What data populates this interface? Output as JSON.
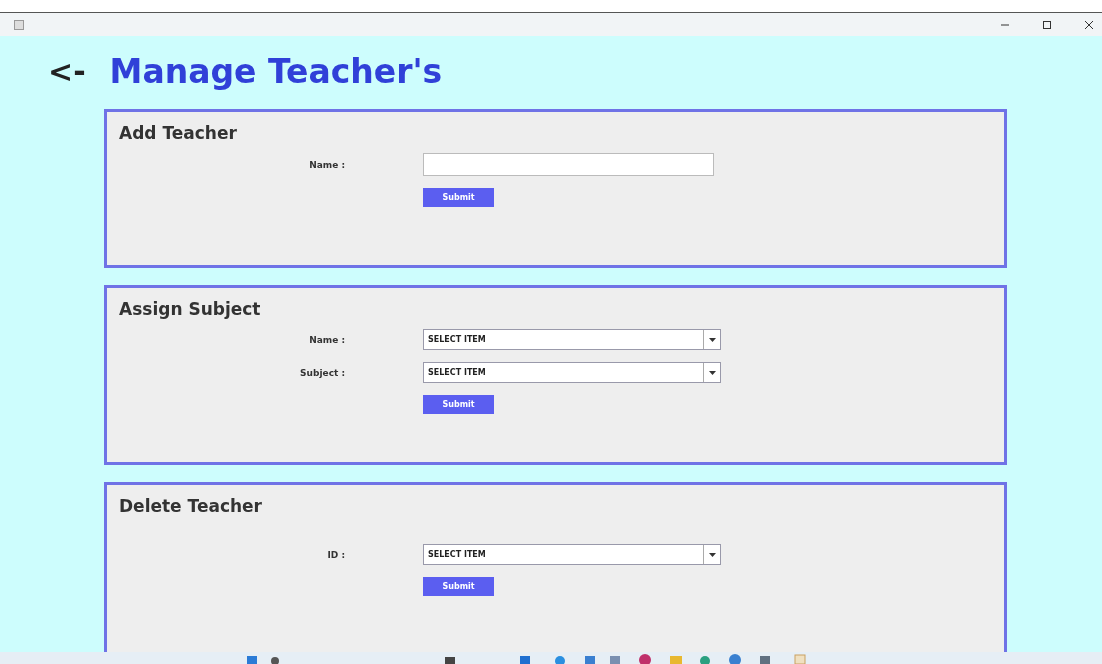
{
  "header": {
    "back": "<-",
    "title": "Manage Teacher's"
  },
  "sections": [
    {
      "heading": "Add Teacher",
      "fields": [
        {
          "kind": "text",
          "label": "Name :"
        }
      ],
      "button": "Submit"
    },
    {
      "heading": "Assign Subject",
      "fields": [
        {
          "kind": "select",
          "label": "Name  :",
          "value": "SELECT ITEM"
        },
        {
          "kind": "select",
          "label": "Subject :",
          "value": "SELECT ITEM"
        }
      ],
      "button": "Submit"
    },
    {
      "heading": "Delete Teacher",
      "fields": [
        {
          "kind": "select",
          "label": "ID :",
          "value": "SELECT ITEM"
        }
      ],
      "button": "Submit"
    }
  ]
}
